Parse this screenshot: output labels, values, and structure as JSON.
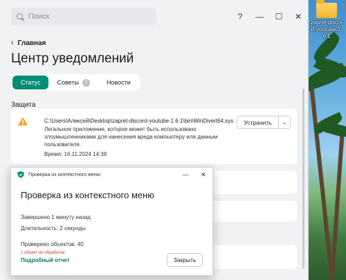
{
  "desktop": {
    "icon_label": "zapret-discord-youtube-1.6.1"
  },
  "app": {
    "search_placeholder": "Поиск",
    "help_glyph": "?",
    "back_label": "Главная",
    "page_title": "Центр уведомлений",
    "tabs": [
      {
        "label": "Статус",
        "active": true
      },
      {
        "label": "Советы",
        "badge": "2"
      },
      {
        "label": "Новости"
      }
    ],
    "section_title": "Защита",
    "alert": {
      "path": "C:\\Users\\Алексей\\Desktop\\zapret-discord-youtube-1.6.1\\bin\\WinDivert64.sys",
      "description": "Легальное приложение, которое может быть использовано злоумышленниками для нанесения вреда компьютеру или данным пользователя.",
      "time": "Время: 16.11.2024 14:38",
      "fix_label": "Устранить"
    }
  },
  "dialog": {
    "window_title": "Проверка из контекстного меню",
    "heading": "Проверка из контекстного меню",
    "completed": "Завершено 1 минуту назад",
    "duration": "Длительность: 2 секунды",
    "checked": "Проверено объектов: 40",
    "unprocessed": "1 объект не обработан",
    "details_link": "Подробный отчет",
    "close_label": "Закрыть"
  },
  "colors": {
    "accent": "#008e73",
    "link": "#007a63",
    "warning": "#f5a623",
    "error": "#d32f2f"
  }
}
